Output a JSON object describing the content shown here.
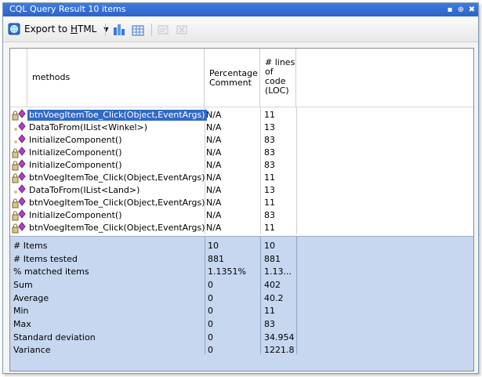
{
  "window": {
    "title": "CQL Query Result 10 items"
  },
  "title_buttons": {
    "pin": "▪",
    "pushpin": "⊕",
    "close": "✖"
  },
  "toolbar": {
    "export_label": "Export to HTML",
    "export_accel": "H",
    "dropdown_arrow": "▼"
  },
  "columns": {
    "methods": "methods",
    "pct": "Percentage\nComment",
    "loc": "# lines\nof\ncode\n(LOC)"
  },
  "rows": [
    {
      "method": "btnVoegItemToe_Click(Object,EventArgs)",
      "pct": "N/A",
      "loc": "11",
      "icon": "lock-method-icon"
    },
    {
      "method": "DataToFrom(IList<Winkel>)",
      "pct": "N/A",
      "loc": "13",
      "icon": "method-icon"
    },
    {
      "method": "InitializeComponent()",
      "pct": "N/A",
      "loc": "83",
      "icon": "method-icon"
    },
    {
      "method": "InitializeComponent()",
      "pct": "N/A",
      "loc": "83",
      "icon": "lock-method-icon"
    },
    {
      "method": "InitializeComponent()",
      "pct": "N/A",
      "loc": "83",
      "icon": "lock-method-icon"
    },
    {
      "method": "btnVoegItemToe_Click(Object,EventArgs)",
      "pct": "N/A",
      "loc": "11",
      "icon": "lock-method-icon"
    },
    {
      "method": "DataToFrom(IList<Land>)",
      "pct": "N/A",
      "loc": "13",
      "icon": "method-icon"
    },
    {
      "method": "btnVoegItemToe_Click(Object,EventArgs)",
      "pct": "N/A",
      "loc": "11",
      "icon": "lock-method-icon"
    },
    {
      "method": "InitializeComponent()",
      "pct": "N/A",
      "loc": "83",
      "icon": "lock-method-icon"
    },
    {
      "method": "btnVoegItemToe_Click(Object,EventArgs)",
      "pct": "N/A",
      "loc": "11",
      "icon": "lock-method-icon"
    }
  ],
  "stats": [
    {
      "label": "# Items",
      "pct": "10",
      "loc": "10"
    },
    {
      "label": "# Items tested",
      "pct": "881",
      "loc": "881"
    },
    {
      "label": "% matched items",
      "pct": "1.1351%",
      "loc": "1.13..."
    },
    {
      "label": "Sum",
      "pct": "0",
      "loc": "402"
    },
    {
      "label": "Average",
      "pct": "0",
      "loc": "40.2"
    },
    {
      "label": "Min",
      "pct": "0",
      "loc": "11"
    },
    {
      "label": "Max",
      "pct": "0",
      "loc": "83"
    },
    {
      "label": "Standard deviation",
      "pct": "0",
      "loc": "34.954"
    },
    {
      "label": "Variance",
      "pct": "0",
      "loc": "1221.8"
    }
  ],
  "colors": {
    "titlebar": "#2d63c8",
    "selection": "#3169c6",
    "stats_bg": "#c6d7ef"
  }
}
